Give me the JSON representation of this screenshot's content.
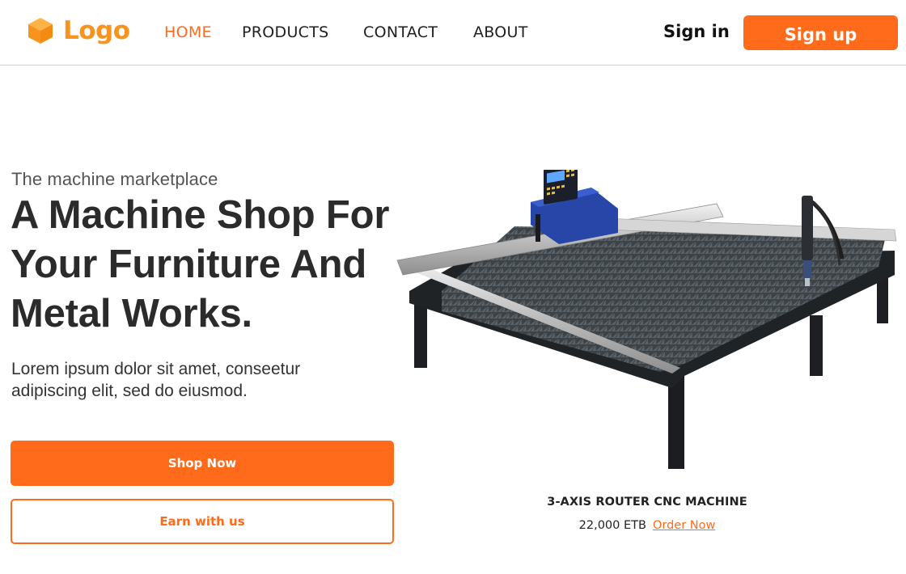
{
  "header": {
    "logo_text": "Logo",
    "nav": [
      {
        "label": "HOME",
        "active": true
      },
      {
        "label": "PRODUCTS",
        "active": false
      },
      {
        "label": "CONTACT",
        "active": false
      },
      {
        "label": "ABOUT",
        "active": false
      }
    ],
    "sign_in_label": "Sign in",
    "sign_up_label": "Sign up"
  },
  "hero": {
    "eyebrow": "The machine marketplace",
    "headline_lines": [
      "A Machine Shop For",
      "Your Furniture And",
      "Metal Works."
    ],
    "subtext_lines": [
      "Lorem ipsum dolor sit amet, conseetur",
      "adipiscing elit, sed do eiusmod."
    ],
    "primary_button": "Shop Now",
    "secondary_button": "Earn with us"
  },
  "product": {
    "name": "3-AXIS ROUTER CNC MACHINE",
    "price": "22,000 ETB",
    "order_label": "Order Now"
  },
  "icons": {
    "logo": "cube-icon"
  },
  "colors": {
    "accent": "#ff6b1a",
    "logo": "#f7931e",
    "text": "#222222"
  }
}
